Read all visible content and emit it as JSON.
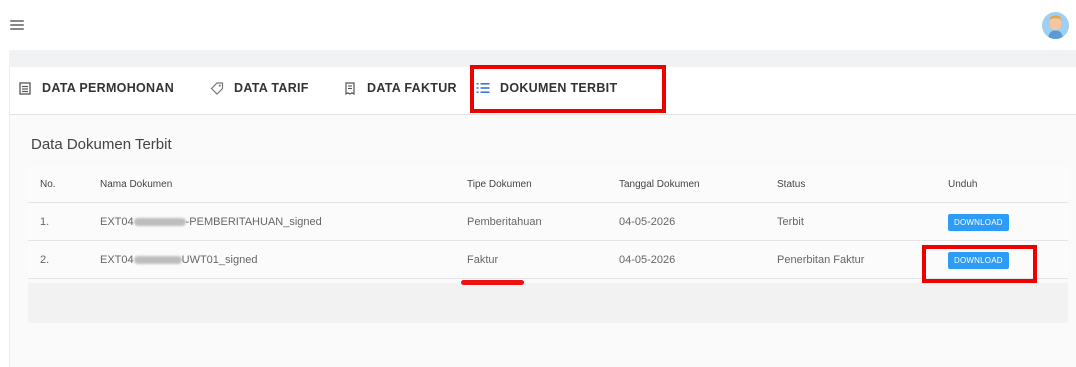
{
  "topbar": {
    "menu_icon": "hamburger-menu-icon",
    "avatar_icon": "user-avatar"
  },
  "tabs": [
    {
      "label": "DATA PERMOHONAN",
      "icon": "document-list-icon"
    },
    {
      "label": "DATA TARIF",
      "icon": "tag-icon"
    },
    {
      "label": "DATA FAKTUR",
      "icon": "receipt-icon"
    },
    {
      "label": "DOKUMEN TERBIT",
      "icon": "list-icon"
    }
  ],
  "section_title": "Data Dokumen Terbit",
  "table": {
    "headers": [
      "No.",
      "Nama Dokumen",
      "Tipe Dokumen",
      "Tanggal Dokumen",
      "Status",
      "Unduh"
    ],
    "rows": [
      {
        "no": "1.",
        "name_prefix": "EXT04",
        "name_suffix": "-PEMBERITAHUAN_signed",
        "type": "Pemberitahuan",
        "date": "04-05-2026",
        "status": "Terbit",
        "action": "DOWNLOAD"
      },
      {
        "no": "2.",
        "name_prefix": "EXT04",
        "name_suffix": "UWT01_signed",
        "type": "Faktur",
        "date": "04-05-2026",
        "status": "Penerbitan Faktur",
        "action": "DOWNLOAD"
      }
    ]
  },
  "colors": {
    "highlight": "#ef0000",
    "button": "#2d9cf6"
  }
}
